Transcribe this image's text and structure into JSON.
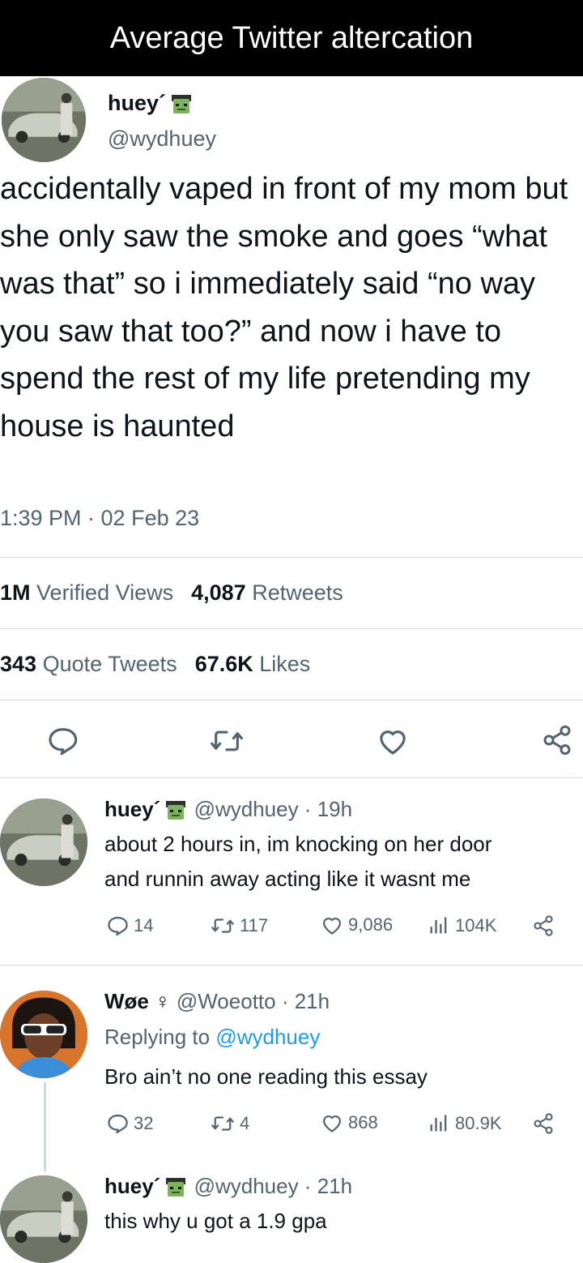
{
  "banner": {
    "title": "Average Twitter altercation"
  },
  "main_tweet": {
    "author_name": "huey´",
    "handle": "@wydhuey",
    "text": "accidentally vaped in front of my mom but she only saw the smoke and goes “what was that” so i immediately said “no way you saw that too?” and now i have to spend the rest of my life pretending my house is haunted",
    "timestamp": "1:39 PM · 02 Feb 23",
    "stats": {
      "views_count": "1M",
      "views_label": "Verified Views",
      "retweets_count": "4,087",
      "retweets_label": "Retweets",
      "quotes_count": "343",
      "quotes_label": "Quote Tweets",
      "likes_count": "67.6K",
      "likes_label": "Likes"
    },
    "actions": [
      "reply-icon",
      "retweet-icon",
      "like-icon",
      "share-icon"
    ]
  },
  "replies": [
    {
      "author_name": "huey´",
      "handle_time": "@wydhuey · 19h",
      "text_lines": [
        "about 2 hours in, im knocking on her door",
        "and runnin away acting like it wasnt me"
      ],
      "replies": "14",
      "retweets": "117",
      "likes": "9,086",
      "views": "104K"
    },
    {
      "author_name": "Wøe ♀",
      "handle_time": "@Woeotto · 21h",
      "replying_prefix": "Replying to",
      "replying_handle": "@wydhuey",
      "text_lines": [
        "Bro ain’t no one reading this essay"
      ],
      "replies": "32",
      "retweets": "4",
      "likes": "868",
      "views": "80.9K"
    },
    {
      "author_name": "huey´",
      "handle_time": "@wydhuey · 21h",
      "text_lines": [
        "this why u got a 1.9 gpa"
      ]
    }
  ],
  "colors": {
    "text": "#0f1419",
    "secondary": "#536471",
    "link": "#1d9bf0",
    "divider": "#cfd9de",
    "banner": "#000000"
  }
}
